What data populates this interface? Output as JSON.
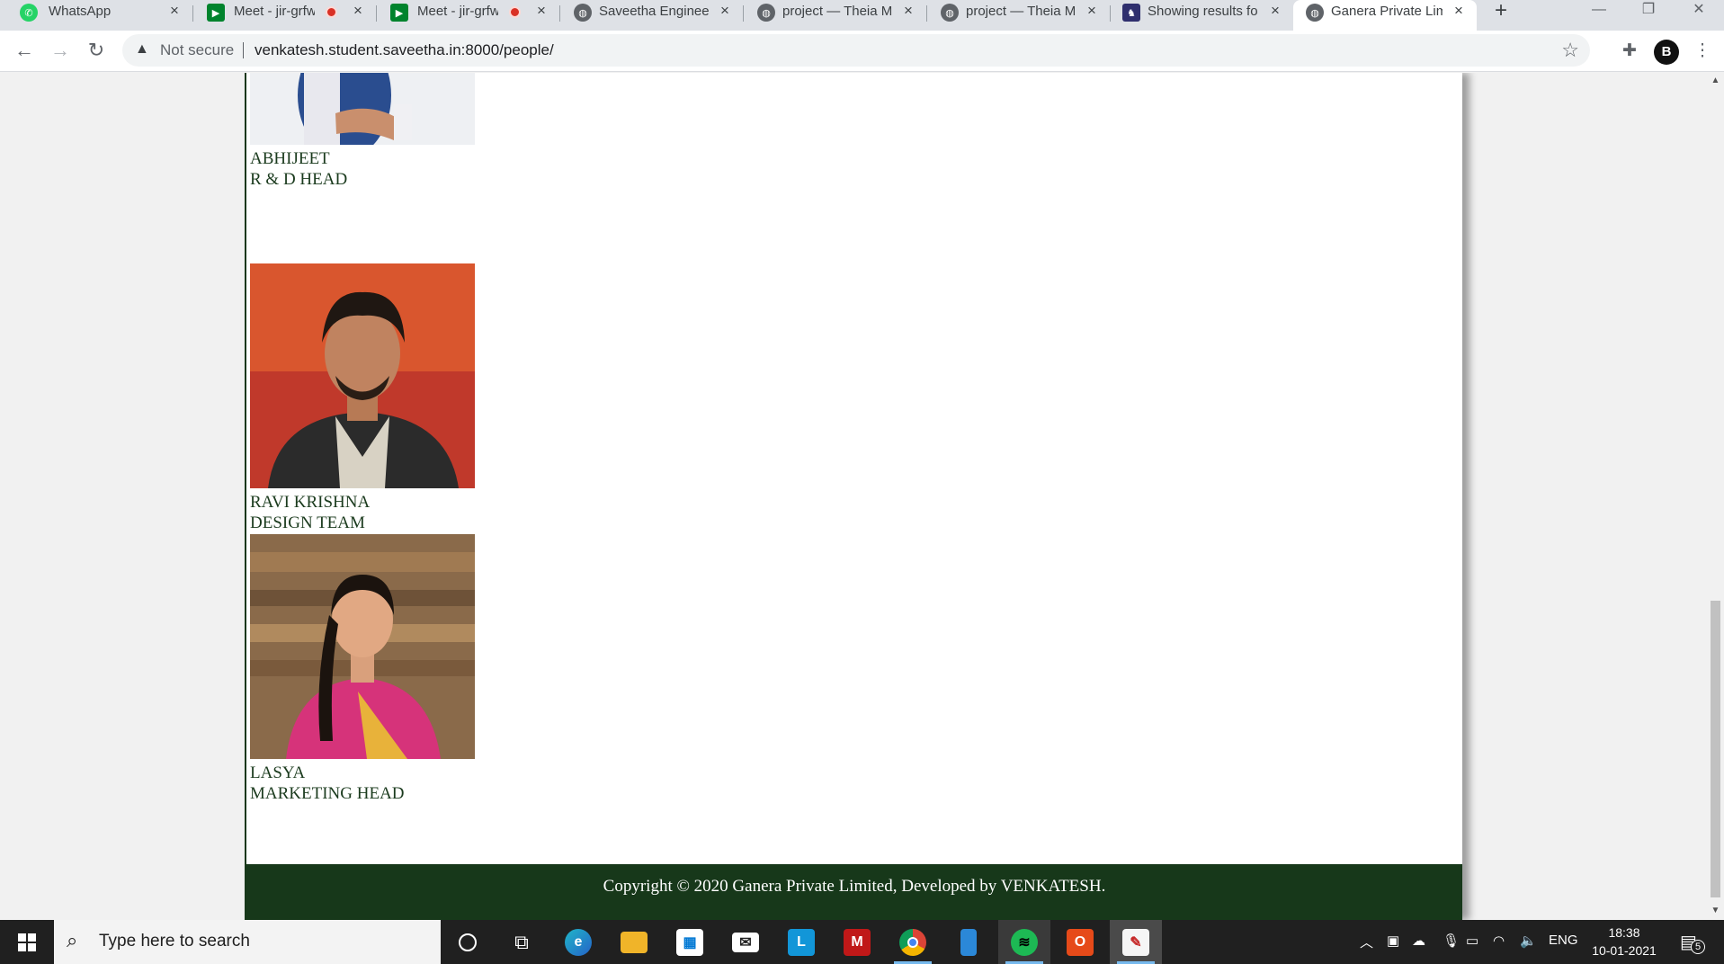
{
  "browser": {
    "tabs": [
      {
        "title": "WhatsApp",
        "icon": "whatsapp-icon",
        "recording": false,
        "active": false
      },
      {
        "title": "Meet - jir-grfw",
        "icon": "google-meet-icon",
        "recording": true,
        "active": false
      },
      {
        "title": "Meet - jir-grfw",
        "icon": "google-meet-icon",
        "recording": true,
        "active": false
      },
      {
        "title": "Saveetha Engineer",
        "icon": "globe-icon",
        "recording": false,
        "active": false
      },
      {
        "title": "project — Theia M",
        "icon": "globe-icon",
        "recording": false,
        "active": false
      },
      {
        "title": "project — Theia M",
        "icon": "globe-icon",
        "recording": false,
        "active": false
      },
      {
        "title": "Showing results fo",
        "icon": "site-icon",
        "recording": false,
        "active": false
      },
      {
        "title": "Ganera Private Lim",
        "icon": "globe-icon",
        "recording": false,
        "active": true
      }
    ],
    "new_tab_label": "+",
    "security_label": "Not secure",
    "url": "venkatesh.student.saveetha.in:8000/people/",
    "profile_initial": "B"
  },
  "page": {
    "members": [
      {
        "name": "ABHIJEET",
        "role": "R & D HEAD"
      },
      {
        "name": "RAVI KRISHNA",
        "role": "DESIGN TEAM"
      },
      {
        "name": "LASYA",
        "role": "MARKETING HEAD"
      }
    ],
    "footer": {
      "copyright": "Copyright © 2020 Ganera Private Limited, Developed by VENKATESH."
    },
    "colors": {
      "accent": "#17381a",
      "text": "#1b3b1e"
    }
  },
  "taskbar": {
    "search_placeholder": "Type here to search",
    "apps": [
      "cortana-icon",
      "task-view-icon",
      "edge-icon",
      "file-explorer-icon",
      "store-icon",
      "mail-icon",
      "l-app-icon",
      "mcafee-icon",
      "chrome-icon",
      "phone-app-icon",
      "spotify-icon",
      "office-icon",
      "paint-icon"
    ],
    "language": "ENG",
    "time": "18:38",
    "date": "10-01-2021",
    "notification_count": "5"
  }
}
